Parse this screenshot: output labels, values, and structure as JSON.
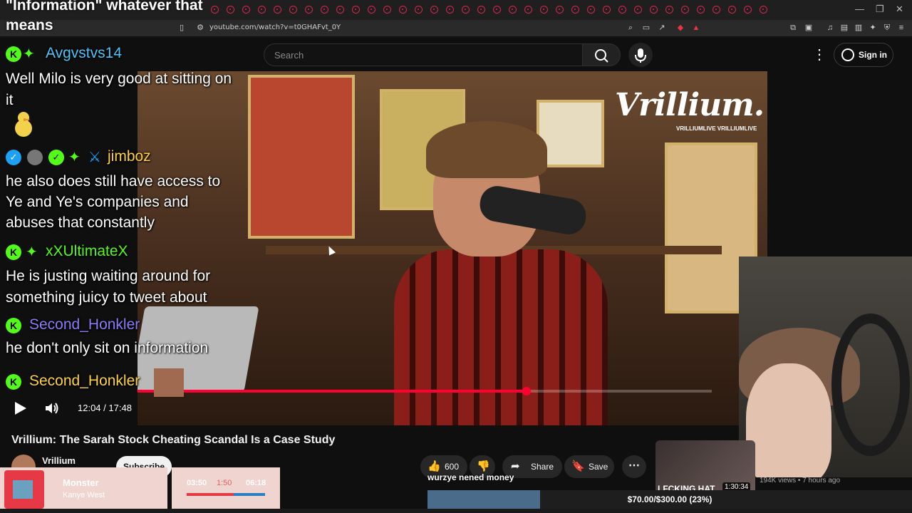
{
  "browser": {
    "url": "youtube.com/watch?v=t0GHAFvt_0Y",
    "overlay_title": "\"Information\" whatever that means"
  },
  "header": {
    "search_placeholder": "Search",
    "sign_in_label": "Sign in"
  },
  "video": {
    "brand_logo": "Vrillium.",
    "brand_handles": "VRILLIUMLIVE   VRILLIUMLIVE",
    "current_time": "12:04",
    "duration": "17:48",
    "progress_fraction": 0.677
  },
  "chat": [
    {
      "user": "Avgvstvs14",
      "user_color": "#4fc3f7",
      "message": "Well Milo is very good at sitting on it"
    },
    {
      "user": "jimboz",
      "user_color": "#ffd23f",
      "message": "he also does still have access to Ye and Ye's companies and abuses that constantly"
    },
    {
      "user": "xXUltimateX",
      "user_color": "#53fc18",
      "message": "He is justing waiting around for something juicy to tweet about"
    },
    {
      "user": "Second_Honkler",
      "user_color": "#8b7cf6",
      "message": "he don't only sit on information"
    },
    {
      "user": "Second_Honkler",
      "user_color": "#ffd23f",
      "message": ""
    }
  ],
  "meta": {
    "title": "Vrillium: The Sarah Stock Cheating Scandal Is a Case Study",
    "channel": "Vrillium",
    "subscribe_label": "Subscribe",
    "like_count": "600",
    "share_label": "Share",
    "save_label": "Save"
  },
  "recommendation": {
    "title": "LFCKING HAT",
    "duration": "1:30:34",
    "meta": "194K views • 7 hours ago"
  },
  "music": {
    "title": "Monster",
    "artist": "Kanye West",
    "current": "03:50",
    "mid": "1:50",
    "total": "06:18",
    "progress_fraction": 0.6
  },
  "caption": "wurzye nened money",
  "goal": {
    "text": "$70.00/$300.00 (23%)",
    "fraction": 0.233
  },
  "colors": {
    "youtube_red": "#ff0033",
    "kick_green": "#53fc18"
  }
}
